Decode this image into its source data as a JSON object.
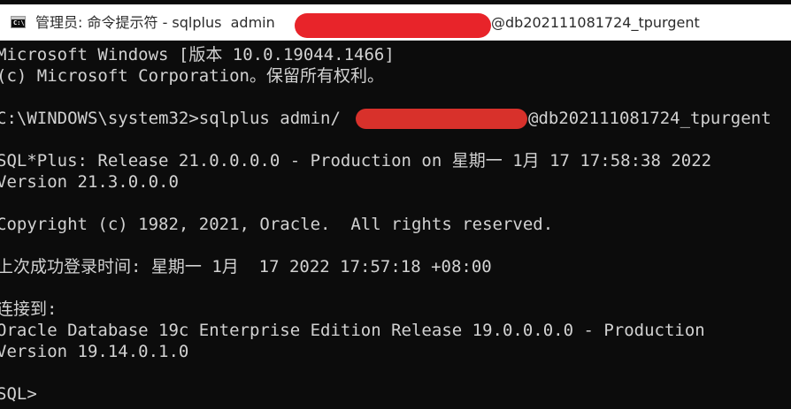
{
  "window": {
    "icon_label": "C:\\",
    "title_prefix": "管理员: 命令提示符 - sqlplus  admin",
    "title_suffix": "@db202111081724_tpurgent"
  },
  "console": {
    "lines": [
      "Microsoft Windows [版本 10.0.19044.1466]",
      "(c) Microsoft Corporation。保留所有权利。",
      "",
      "C:\\WINDOWS\\system32>sqlplus admin/",
      "",
      "SQL*Plus: Release 21.0.0.0.0 - Production on 星期一 1月 17 17:58:38 2022",
      "Version 21.3.0.0.0",
      "",
      "Copyright (c) 1982, 2021, Oracle.  All rights reserved.",
      "",
      "上次成功登录时间: 星期一 1月  17 2022 17:57:18 +08:00",
      "",
      "连接到:",
      "Oracle Database 19c Enterprise Edition Release 19.0.0.0.0 - Production",
      "Version 19.14.0.1.0",
      "",
      "SQL>"
    ],
    "command_tail": "@db202111081724_tpurgent"
  },
  "colors": {
    "console_bg": "#0c0c0c",
    "console_text": "#d2d2d2",
    "titlebar_bg": "#ffffff",
    "redaction": "#e8242a"
  }
}
